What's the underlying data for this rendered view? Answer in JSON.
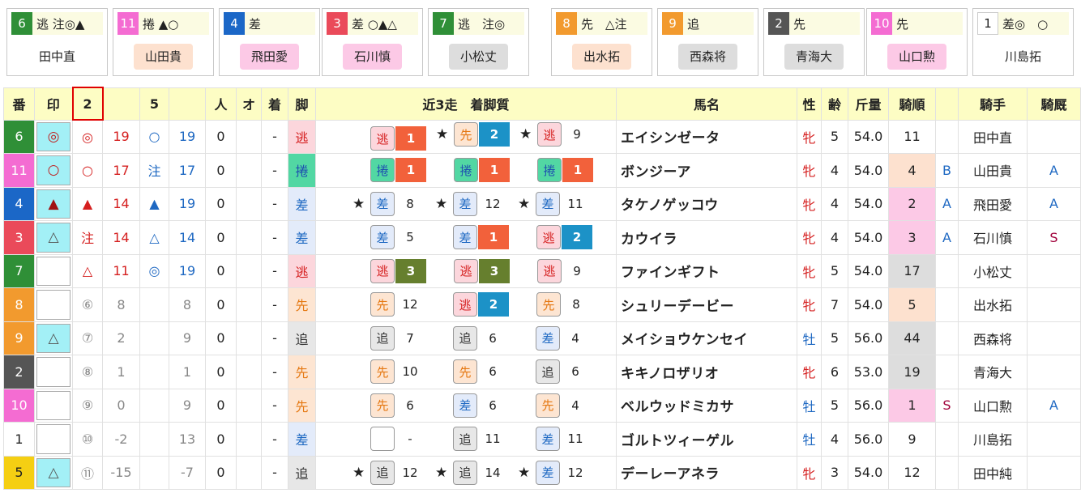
{
  "colors": {
    "waku": {
      "1": "#ffffff",
      "2": "#555555",
      "3": "#ea4a5a",
      "4": "#1b67c7",
      "5": "#f5cf13",
      "6": "#2f8f37",
      "7": "#2f8f37",
      "8": "#f29a2e",
      "9": "#f29a2e",
      "10": "#f46cd2",
      "11": "#f46cd2"
    },
    "tag_bg": {
      "逃": "#fcd6dc",
      "捲": "#52d7a3",
      "先": "#fde5d2",
      "差": "#e3ebfa",
      "追": "#e7e7e7",
      "": "#ffffff"
    },
    "tag_fg": {
      "逃": "#d51f1f",
      "捲": "#1e4fb0",
      "先": "#e57812",
      "差": "#1e68c2",
      "追": "#333333",
      "": "#333333"
    },
    "rank_bg": {
      "1": "#f2613b",
      "2": "#1c92c7",
      "3": "#667f2e"
    },
    "jockey_bg": {
      "pink": "#fcc9e6",
      "peach": "#fde1cf",
      "gray": "#dddddd",
      "none": "#ffffff"
    },
    "mark_cell_bg": "#a3f0f6"
  },
  "cards": [
    {
      "uma": "6",
      "marks": "逃 注◎▲",
      "jockey": "田中直",
      "jbg": "none"
    },
    {
      "uma": "11",
      "marks": "捲 ▲○",
      "jockey": "山田貴",
      "jbg": "peach"
    },
    {
      "uma": "4",
      "marks": "差",
      "jockey": "飛田愛",
      "jbg": "pink"
    },
    {
      "uma": "3",
      "marks": "差 ○▲△",
      "jockey": "石川慎",
      "jbg": "pink"
    },
    {
      "uma": "7",
      "marks": "逃　注◎",
      "jockey": "小松丈",
      "jbg": "gray"
    },
    {
      "uma": "8",
      "marks": "先　△注",
      "jockey": "出水拓",
      "jbg": "peach"
    },
    {
      "uma": "9",
      "marks": "追",
      "jockey": "西森将",
      "jbg": "gray"
    },
    {
      "uma": "2",
      "marks": "先",
      "jockey": "青海大",
      "jbg": "gray"
    },
    {
      "uma": "10",
      "marks": "先",
      "jockey": "山口勲",
      "jbg": "pink"
    },
    {
      "uma": "1",
      "marks": "差◎　○",
      "jockey": "川島拓",
      "jbg": "none"
    }
  ],
  "headers": {
    "ban": "番",
    "shirushi": "印",
    "c2": "2",
    "c3": "",
    "c4": "5",
    "c5": "",
    "c6": "人",
    "c7": "オ",
    "c8": "着",
    "kyaku": "脚",
    "recent": "近3走　着脚質",
    "name": "馬名",
    "sex": "性",
    "age": "齢",
    "kin": "斤量",
    "kijun": "騎順",
    "kx": "",
    "jockey": "騎手",
    "kirei": "騎厩"
  },
  "rows": [
    {
      "uma": "6",
      "mark": "◎",
      "m2": "◎",
      "v2": "19",
      "m5": "○",
      "v5": "19",
      "ninki": "0",
      "o": "",
      "chaku": "-",
      "kyaku": "逃",
      "recent": [
        {
          "star": "",
          "tag": "逃",
          "rank": "1"
        },
        {
          "star": "★",
          "tag": "先",
          "rank": "2"
        },
        {
          "star": "★",
          "tag": "逃",
          "rank": "9"
        }
      ],
      "name": "エイシンゼータ",
      "sex": "牝",
      "age": "5",
      "kin": "54.0",
      "kijun": "11",
      "kjbg": "none",
      "kx": "",
      "jockey": "田中直",
      "kirei": ""
    },
    {
      "uma": "11",
      "mark": "○",
      "m2": "○",
      "v2": "17",
      "m5": "注",
      "v5": "17",
      "ninki": "0",
      "o": "",
      "chaku": "-",
      "kyaku": "捲",
      "recent": [
        {
          "star": "",
          "tag": "捲",
          "rank": "1"
        },
        {
          "star": "",
          "tag": "捲",
          "rank": "1"
        },
        {
          "star": "",
          "tag": "捲",
          "rank": "1"
        }
      ],
      "name": "ボンジーア",
      "sex": "牝",
      "age": "4",
      "kin": "54.0",
      "kijun": "4",
      "kjbg": "peach",
      "kx": "B",
      "jockey": "山田貴",
      "kirei": "A"
    },
    {
      "uma": "4",
      "mark": "▲",
      "m2": "▲",
      "v2": "14",
      "m5": "▲",
      "v5": "19",
      "ninki": "0",
      "o": "",
      "chaku": "-",
      "kyaku": "差",
      "recent": [
        {
          "star": "★",
          "tag": "差",
          "rank": "8"
        },
        {
          "star": "★",
          "tag": "差",
          "rank": "12"
        },
        {
          "star": "★",
          "tag": "差",
          "rank": "11"
        }
      ],
      "name": "タケノゲッコウ",
      "sex": "牝",
      "age": "4",
      "kin": "54.0",
      "kijun": "2",
      "kjbg": "pink",
      "kx": "A",
      "jockey": "飛田愛",
      "kirei": "A"
    },
    {
      "uma": "3",
      "mark": "△",
      "m2": "注",
      "v2": "14",
      "m5": "△",
      "v5": "14",
      "ninki": "0",
      "o": "",
      "chaku": "-",
      "kyaku": "差",
      "recent": [
        {
          "star": "",
          "tag": "差",
          "rank": "5"
        },
        {
          "star": "",
          "tag": "差",
          "rank": "1"
        },
        {
          "star": "",
          "tag": "逃",
          "rank": "2"
        }
      ],
      "name": "カウイラ",
      "sex": "牝",
      "age": "4",
      "kin": "54.0",
      "kijun": "3",
      "kjbg": "pink",
      "kx": "A",
      "jockey": "石川慎",
      "kirei": "S"
    },
    {
      "uma": "7",
      "mark": "",
      "m2": "△",
      "v2": "11",
      "m5": "◎",
      "v5": "19",
      "ninki": "0",
      "o": "",
      "chaku": "-",
      "kyaku": "逃",
      "recent": [
        {
          "star": "",
          "tag": "逃",
          "rank": "3"
        },
        {
          "star": "",
          "tag": "逃",
          "rank": "3"
        },
        {
          "star": "",
          "tag": "逃",
          "rank": "9"
        }
      ],
      "name": "ファインギフト",
      "sex": "牝",
      "age": "5",
      "kin": "54.0",
      "kijun": "17",
      "kjbg": "gray",
      "kx": "",
      "jockey": "小松丈",
      "kirei": ""
    },
    {
      "uma": "8",
      "mark": "",
      "m2": "⑥",
      "v2": "8",
      "m5": "",
      "v5": "8",
      "ninki": "0",
      "o": "",
      "chaku": "-",
      "kyaku": "先",
      "recent": [
        {
          "star": "",
          "tag": "先",
          "rank": "12"
        },
        {
          "star": "",
          "tag": "逃",
          "rank": "2"
        },
        {
          "star": "",
          "tag": "先",
          "rank": "8"
        }
      ],
      "name": "シュリーデービー",
      "sex": "牝",
      "age": "7",
      "kin": "54.0",
      "kijun": "5",
      "kjbg": "peach",
      "kx": "",
      "jockey": "出水拓",
      "kirei": ""
    },
    {
      "uma": "9",
      "mark": "△",
      "m2": "⑦",
      "v2": "2",
      "m5": "",
      "v5": "9",
      "ninki": "0",
      "o": "",
      "chaku": "-",
      "kyaku": "追",
      "recent": [
        {
          "star": "",
          "tag": "追",
          "rank": "7"
        },
        {
          "star": "",
          "tag": "追",
          "rank": "6"
        },
        {
          "star": "",
          "tag": "差",
          "rank": "4"
        }
      ],
      "name": "メイショウケンセイ",
      "sex": "牡",
      "age": "5",
      "kin": "56.0",
      "kijun": "44",
      "kjbg": "gray",
      "kx": "",
      "jockey": "西森将",
      "kirei": ""
    },
    {
      "uma": "2",
      "mark": "",
      "m2": "⑧",
      "v2": "1",
      "m5": "",
      "v5": "1",
      "ninki": "0",
      "o": "",
      "chaku": "-",
      "kyaku": "先",
      "recent": [
        {
          "star": "",
          "tag": "先",
          "rank": "10"
        },
        {
          "star": "",
          "tag": "先",
          "rank": "6"
        },
        {
          "star": "",
          "tag": "追",
          "rank": "6"
        }
      ],
      "name": "キキノロザリオ",
      "sex": "牝",
      "age": "6",
      "kin": "53.0",
      "kijun": "19",
      "kjbg": "gray",
      "kx": "",
      "jockey": "青海大",
      "kirei": ""
    },
    {
      "uma": "10",
      "mark": "",
      "m2": "⑨",
      "v2": "0",
      "m5": "",
      "v5": "9",
      "ninki": "0",
      "o": "",
      "chaku": "-",
      "kyaku": "先",
      "recent": [
        {
          "star": "",
          "tag": "先",
          "rank": "6"
        },
        {
          "star": "",
          "tag": "差",
          "rank": "6"
        },
        {
          "star": "",
          "tag": "先",
          "rank": "4"
        }
      ],
      "name": "ベルウッドミカサ",
      "sex": "牡",
      "age": "5",
      "kin": "56.0",
      "kijun": "1",
      "kjbg": "pink",
      "kx": "S",
      "jockey": "山口勲",
      "kirei": "A"
    },
    {
      "uma": "1",
      "mark": "",
      "m2": "⑩",
      "v2": "-2",
      "m5": "",
      "v5": "13",
      "ninki": "0",
      "o": "",
      "chaku": "-",
      "kyaku": "差",
      "recent": [
        {
          "star": "",
          "tag": "",
          "rank": "-"
        },
        {
          "star": "",
          "tag": "追",
          "rank": "11"
        },
        {
          "star": "",
          "tag": "差",
          "rank": "11"
        }
      ],
      "name": "ゴルトツィーゲル",
      "sex": "牡",
      "age": "4",
      "kin": "56.0",
      "kijun": "9",
      "kjbg": "none",
      "kx": "",
      "jockey": "川島拓",
      "kirei": ""
    },
    {
      "uma": "5",
      "mark": "△",
      "m2": "⑪",
      "v2": "-15",
      "m5": "",
      "v5": "-7",
      "ninki": "0",
      "o": "",
      "chaku": "-",
      "kyaku": "追",
      "recent": [
        {
          "star": "★",
          "tag": "追",
          "rank": "12"
        },
        {
          "star": "★",
          "tag": "追",
          "rank": "14"
        },
        {
          "star": "★",
          "tag": "差",
          "rank": "12"
        }
      ],
      "name": "デーレーアネラ",
      "sex": "牝",
      "age": "3",
      "kin": "54.0",
      "kijun": "12",
      "kjbg": "none",
      "kx": "",
      "jockey": "田中純",
      "kirei": ""
    }
  ]
}
